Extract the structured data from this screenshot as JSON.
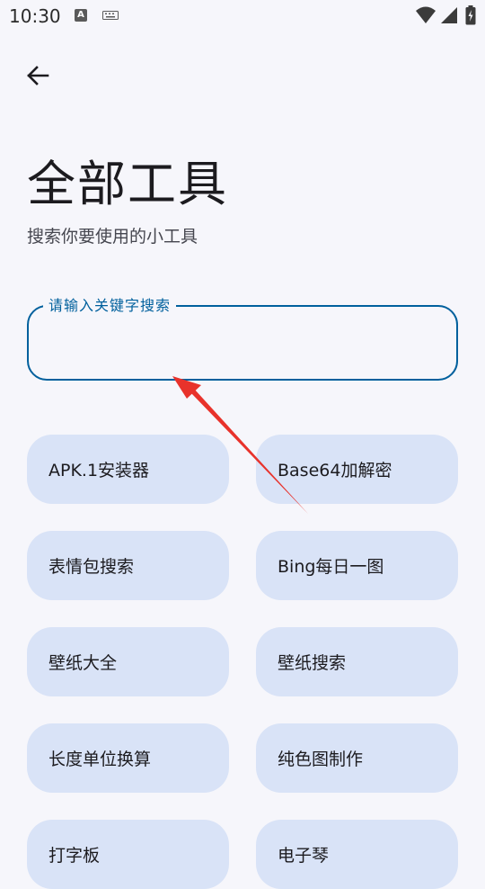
{
  "status_bar": {
    "time": "10:30",
    "icons": [
      "text-a-icon",
      "keyboard-icon",
      "wifi-icon",
      "signal-icon",
      "battery-icon"
    ]
  },
  "header": {
    "back_icon": "back-arrow-icon"
  },
  "page": {
    "title": "全部工具",
    "subtitle": "搜索你要使用的小工具"
  },
  "search": {
    "label": "请输入关键字搜索",
    "value": ""
  },
  "tools": [
    {
      "label": "APK.1安装器"
    },
    {
      "label": "Base64加解密"
    },
    {
      "label": "表情包搜索"
    },
    {
      "label": "Bing每日一图"
    },
    {
      "label": "壁纸大全"
    },
    {
      "label": "壁纸搜索"
    },
    {
      "label": "长度单位换算"
    },
    {
      "label": "纯色图制作"
    },
    {
      "label": "打字板"
    },
    {
      "label": "电子琴"
    }
  ],
  "colors": {
    "background": "#f6f6fb",
    "accent": "#00609d",
    "card": "#d9e3f7",
    "annotation_arrow": "#e8322b"
  }
}
